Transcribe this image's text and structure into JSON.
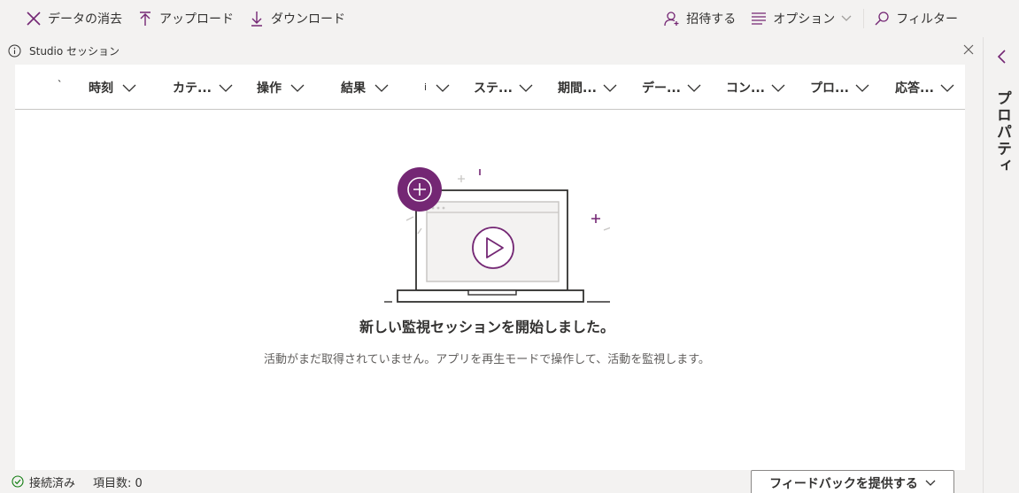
{
  "toolbar": {
    "clear_data": "データの消去",
    "upload": "アップロード",
    "download": "ダウンロード",
    "invite": "招待する",
    "options": "オプション",
    "filter": "フィルター"
  },
  "infobar": {
    "session_label": "Studio セッション"
  },
  "columns": [
    "`",
    "時刻",
    "カテ...",
    "操作",
    "結果",
    "i",
    "ステ...",
    "期間...",
    "デー...",
    "コン...",
    "プロ...",
    "応答..."
  ],
  "empty_state": {
    "title": "新しい監視セッションを開始しました。",
    "description": "活動がまだ取得されていません。アプリを再生モードで操作して、活動を監視します。"
  },
  "sidebar": {
    "label": "プロパティ"
  },
  "status": {
    "connected": "接続済み",
    "items_count": "項目数: 0"
  },
  "feedback": {
    "label": "フィードバックを提供する"
  },
  "colors": {
    "accent": "#742774",
    "text": "#323130",
    "background": "#f3f2f1",
    "panel": "#ffffff"
  }
}
